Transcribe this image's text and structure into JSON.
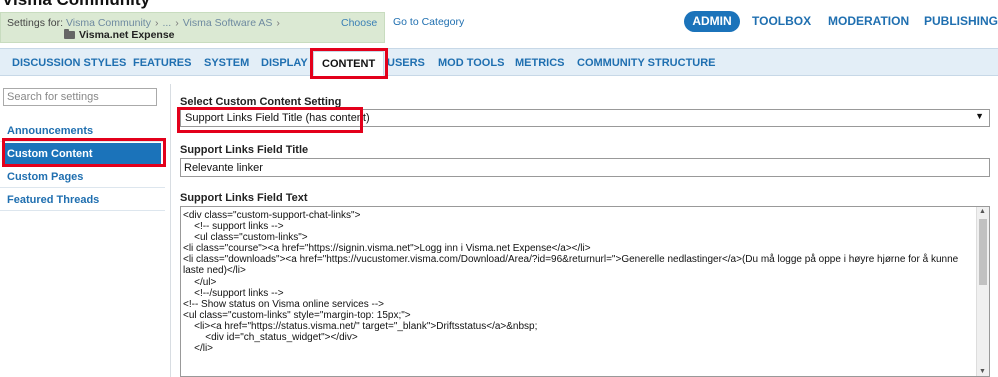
{
  "app_title": "Visma Community",
  "breadcrumb": {
    "prefix": "Settings for:",
    "items": [
      "Visma Community",
      "...",
      "Visma Software AS"
    ],
    "separator": "›",
    "current": "Visma.net Expense",
    "choose_label": "Choose",
    "goto_label": "Go to Category"
  },
  "top_nav": {
    "items": [
      "ADMIN",
      "TOOLBOX",
      "MODERATION",
      "PUBLISHING"
    ],
    "active": "ADMIN"
  },
  "tabs": {
    "items": [
      "DISCUSSION STYLES",
      "FEATURES",
      "SYSTEM",
      "DISPLAY",
      "CONTENT",
      "USERS",
      "MOD TOOLS",
      "METRICS",
      "COMMUNITY STRUCTURE"
    ],
    "active": "CONTENT"
  },
  "sidebar": {
    "search_placeholder": "Search for settings",
    "items": [
      "Announcements",
      "Custom Content",
      "Custom Pages",
      "Featured Threads"
    ],
    "active": "Custom Content"
  },
  "main": {
    "select_label": "Select Custom Content Setting",
    "select_value": "Support Links Field Title (has content)",
    "title_label": "Support Links Field Title",
    "title_value": "Relevante linker",
    "text_label": "Support Links Field Text",
    "code_lines": [
      "<div class=\"custom-support-chat-links\">",
      "    <!-- support links -->",
      "    <ul class=\"custom-links\">",
      "<li class=\"course\"><a href=\"https://signin.visma.net\">Logg inn i Visma.net Expense</a></li>",
      "<li class=\"downloads\"><a href=\"https://vucustomer.visma.com/Download/Area/?id=96&returnurl=\">Generelle nedlastinger</a>(Du må logge på oppe i høyre hjørne for å kunne laste ned)</li>",
      "    </ul>",
      "    <!--/support links -->",
      "",
      "<!-- Show status on Visma online services -->",
      "<ul class=\"custom-links\" style=\"margin-top: 15px;\">",
      "    <li><a href=\"https://status.visma.net/\" target=\"_blank\">Driftsstatus</a>&nbsp;",
      "        <div id=\"ch_status_widget\"></div>",
      "    </li>"
    ]
  },
  "colors": {
    "accent": "#1b73ba",
    "link": "#1f6fb0",
    "highlight_border": "#e3001b",
    "breadcrumb_bg": "#dbe9d3",
    "tabs_bg": "#e3eef7"
  }
}
